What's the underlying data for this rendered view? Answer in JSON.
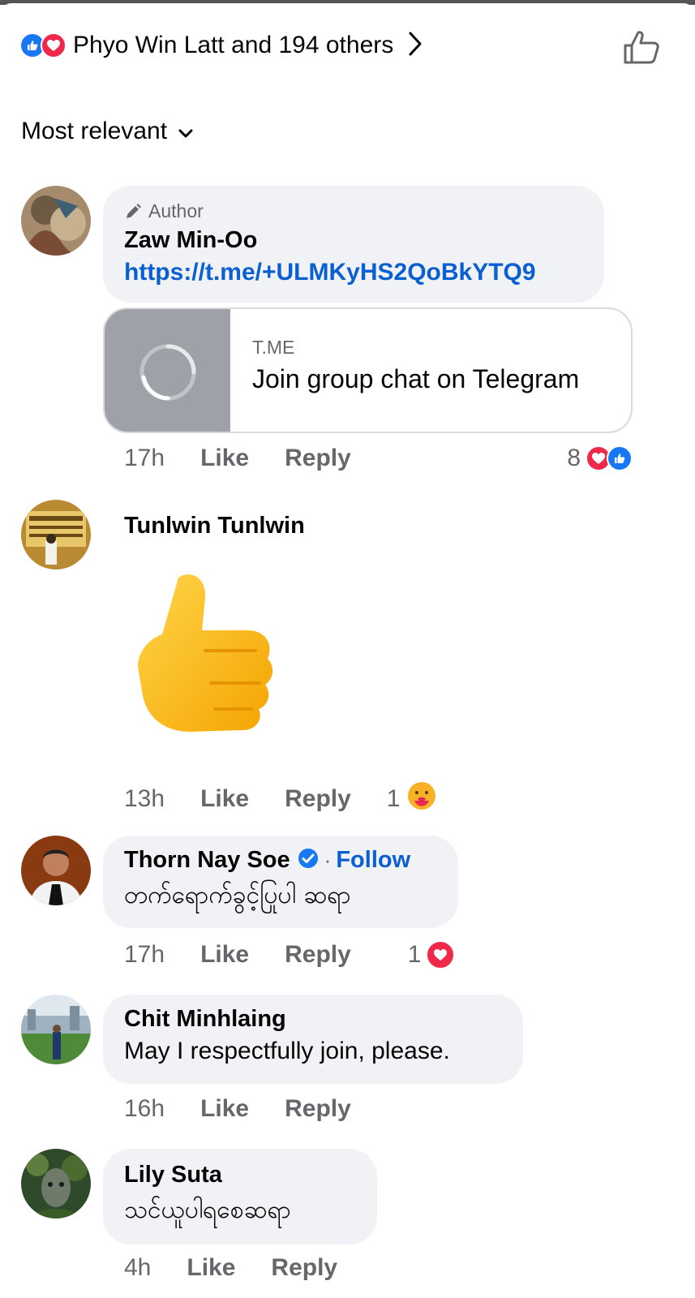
{
  "reactions": {
    "summary": "Phyo Win Latt and 194 others"
  },
  "sort": {
    "label": "Most relevant"
  },
  "comments": [
    {
      "author_badge": "Author",
      "name": "Zaw Min-Oo",
      "link": "https://t.me/+ULMKyHS2QoBkYTQ9",
      "preview": {
        "domain": "T.ME",
        "title": "Join group chat on Telegram"
      },
      "time": "17h",
      "like": "Like",
      "reply": "Reply",
      "reaction_count": "8"
    },
    {
      "name": "Tunlwin Tunlwin",
      "sticker": "thumbs-up-sticker",
      "time": "13h",
      "like": "Like",
      "reply": "Reply",
      "reaction_count": "1"
    },
    {
      "name": "Thorn Nay Soe",
      "verified": true,
      "follow": "Follow",
      "text": "တက်ရောက်ခွင့်ပြုပါ ဆရာ",
      "time": "17h",
      "like": "Like",
      "reply": "Reply",
      "reaction_count": "1"
    },
    {
      "name": "Chit Minhlaing",
      "text": "May I respectfully join, please.",
      "time": "16h",
      "like": "Like",
      "reply": "Reply"
    },
    {
      "name": "Lily Suta",
      "text": "သင်ယူပါရစေဆရာ",
      "time": "4h",
      "like": "Like",
      "reply": "Reply"
    }
  ],
  "colors": {
    "link_blue": "#0a5fd1",
    "like_blue": "#1877f2",
    "love_red": "#f02849",
    "bubble_gray": "#f0f2f5",
    "meta_gray": "#65676b"
  },
  "icons": [
    "like-reaction-icon",
    "love-reaction-icon",
    "chevron-right-icon",
    "thumbs-up-outline-icon",
    "chevron-down-icon",
    "pencil-icon",
    "loading-spinner-icon",
    "verified-icon",
    "care-reaction-icon"
  ]
}
